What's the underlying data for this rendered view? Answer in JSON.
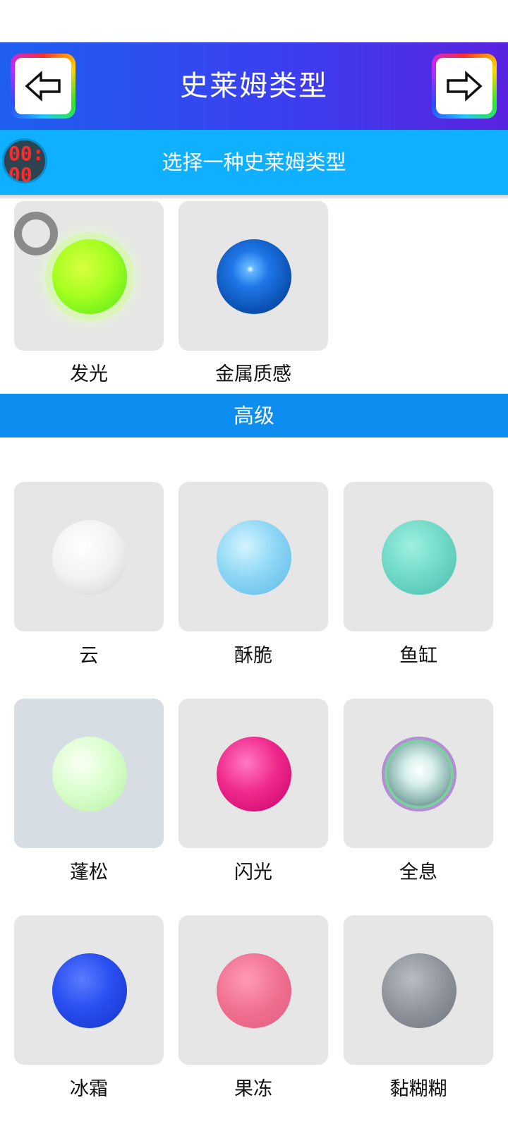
{
  "header": {
    "title": "史莱姆类型",
    "back_icon": "arrow-left-icon",
    "next_icon": "arrow-right-icon"
  },
  "subheader": {
    "text": "选择一种史莱姆类型",
    "timer": "00:00"
  },
  "basic_items": [
    {
      "label": "发光",
      "icon": "glow-slime-icon",
      "color": "#a6ff20"
    },
    {
      "label": "金属质感",
      "icon": "metal-slime-icon",
      "color": "#1f77e8"
    }
  ],
  "section": {
    "title": "高级"
  },
  "advanced_items": [
    {
      "label": "云",
      "icon": "cloud-slime-icon",
      "color": "#f2f2f2"
    },
    {
      "label": "酥脆",
      "icon": "crispy-slime-icon",
      "color": "#8fd8f6"
    },
    {
      "label": "鱼缸",
      "icon": "fishbowl-slime-icon",
      "color": "#6fd8c6"
    },
    {
      "label": "蓬松",
      "icon": "fluffy-slime-icon",
      "color": "#dbffcf",
      "selected": true
    },
    {
      "label": "闪光",
      "icon": "glitter-slime-icon",
      "color": "#f02a8c"
    },
    {
      "label": "全息",
      "icon": "holographic-slime-icon",
      "color": "#8fb8b2"
    },
    {
      "label": "冰霜",
      "icon": "frost-slime-icon",
      "color": "#2a4ef0"
    },
    {
      "label": "果冻",
      "icon": "jelly-slime-icon",
      "color": "#f07090"
    },
    {
      "label": "黏糊糊",
      "icon": "goo-slime-icon",
      "color": "#8f949c"
    }
  ]
}
